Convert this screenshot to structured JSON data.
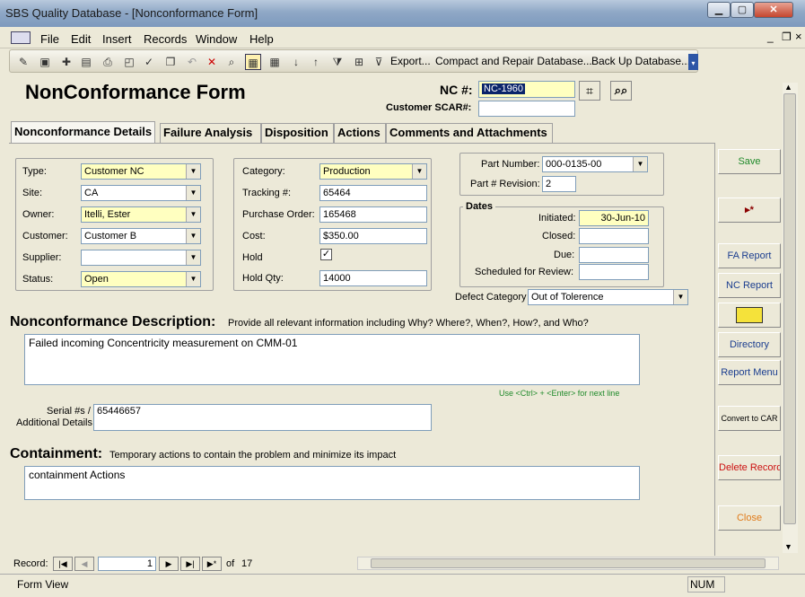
{
  "window": {
    "title": "SBS Quality Database - [Nonconformance Form]",
    "min": "▁",
    "max": "▢",
    "close": "✕",
    "inner_min": "_",
    "inner_restore": "❐",
    "inner_close": "×"
  },
  "menu": [
    "File",
    "Edit",
    "Insert",
    "Records",
    "Window",
    "Help"
  ],
  "toolbar": {
    "export": "Export...",
    "compact": "Compact and Repair Database...",
    "backup": "Back Up Database...",
    "icons": [
      "design-view-icon",
      "open-icon",
      "new-icon",
      "save-icon",
      "print-icon",
      "print-preview-icon",
      "spelling-icon",
      "copy-icon",
      "undo-icon",
      "delete-icon",
      "find-icon",
      "form-view-icon",
      "datasheet-icon",
      "sort-ascending-icon",
      "sort-descending-icon",
      "filter-by-selection-icon",
      "filter-by-form-icon",
      "apply-filter-icon"
    ]
  },
  "form": {
    "title": "NonConformance Form",
    "nc_label": "NC #:",
    "nc_value": "NC-1960",
    "scar_label": "Customer SCAR#:",
    "scar_value": "",
    "tabs": [
      "Nonconformance Details",
      "Failure Analysis",
      "Disposition",
      "Actions",
      "Comments and Attachments"
    ],
    "left_group": [
      {
        "label": "Type:",
        "value": "Customer NC"
      },
      {
        "label": "Site:",
        "value": "CA"
      },
      {
        "label": "Owner:",
        "value": "Itelli, Ester"
      },
      {
        "label": "Customer:",
        "value": "Customer B"
      },
      {
        "label": "Supplier:",
        "value": ""
      },
      {
        "label": "Status:",
        "value": "Open"
      }
    ],
    "mid_group": [
      {
        "label": "Category:",
        "value": "Production"
      },
      {
        "label": "Tracking #:",
        "value": "65464"
      },
      {
        "label": "Purchase Order:",
        "value": "165468"
      },
      {
        "label": "Cost:",
        "value": "$350.00"
      },
      {
        "label": "Hold",
        "value": "✓"
      },
      {
        "label": "Hold Qty:",
        "value": "14000"
      }
    ],
    "part_number_label": "Part Number:",
    "part_number": "000-0135-00",
    "part_rev_label": "Part # Revision:",
    "part_rev": "2",
    "dates_title": "Dates",
    "dates": [
      {
        "label": "Initiated:",
        "value": "30-Jun-10"
      },
      {
        "label": "Closed:",
        "value": ""
      },
      {
        "label": "Due:",
        "value": ""
      },
      {
        "label": "Scheduled for Review:",
        "value": ""
      }
    ],
    "defect_label": "Defect Category",
    "defect_value": "Out of Tolerence",
    "desc_title": "Nonconformance Description:",
    "desc_hint": "Provide all relevant information including Why?  Where?, When?, How?, and Who?",
    "desc_value": "Failed incoming Concentricity measurement on CMM-01",
    "ctrl_hint": "Use <Ctrl> + <Enter> for next line",
    "serial_label_1": "Serial #s /",
    "serial_label_2": "Additional Details:",
    "serial_value": "65446657",
    "cont_title": "Containment:",
    "cont_hint": "Temporary actions to contain the problem and minimize its impact",
    "cont_value": "containment Actions"
  },
  "side": {
    "save": "Save",
    "new_record": "▸*",
    "fa_report": "FA Report",
    "nc_report": "NC Report",
    "directory": "Directory",
    "report_menu": "Report Menu",
    "convert": "Convert to CAR",
    "delete": "Delete Record",
    "close": "Close"
  },
  "colors": {
    "side_blue": "#1a3d8f",
    "side_green": "#1f8a2a",
    "side_red": "#cc1111",
    "side_orange": "#e07b1a",
    "hint_green": "#1f8a2a",
    "field_yellow": "#ffffc0"
  },
  "nav": {
    "label": "Record:",
    "current": "1",
    "of": "of",
    "total": "17"
  },
  "status": {
    "left": "Form View",
    "num": "NUM"
  }
}
